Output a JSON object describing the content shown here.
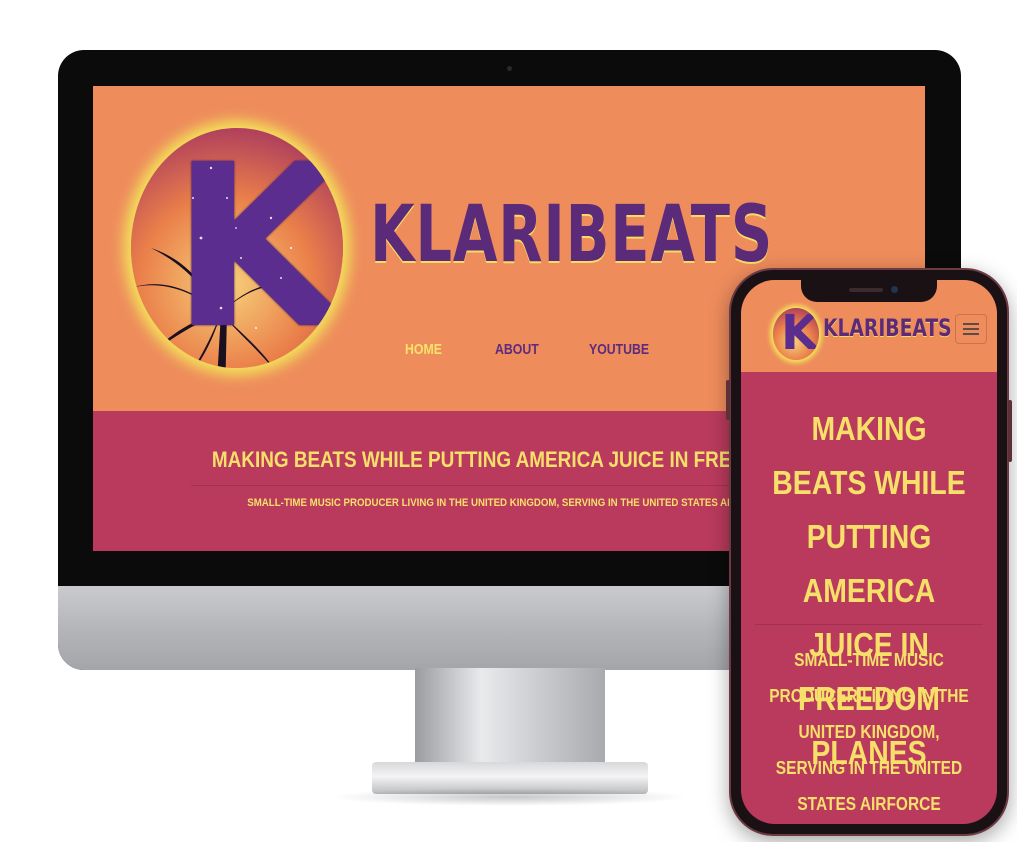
{
  "site": {
    "brand": "KLARIBEATS",
    "nav": [
      {
        "label": "HOME",
        "active": true
      },
      {
        "label": "ABOUT",
        "active": false
      },
      {
        "label": "YOUTUBE",
        "active": false
      }
    ],
    "headline_desktop": "MAKING BEATS WHILE PUTTING AMERICA JUICE IN FREEDOM P",
    "tagline_desktop": "SMALL-TIME MUSIC PRODUCER LIVING IN THE UNITED KINGDOM, SERVING IN THE UNITED STATES AIRFORCE",
    "headline": "MAKING BEATS WHILE PUTTING AMERICA JUICE IN FREEDOM PLANES",
    "tagline": "SMALL-TIME MUSIC PRODUCER LIVING IN THE UNITED KINGDOM, SERVING IN THE UNITED STATES AIRFORCE",
    "logo_letter": "K"
  },
  "colors": {
    "header_bg": "#ee8c5c",
    "hero_bg": "#b93a5c",
    "brand_purple": "#5b2b7a",
    "accent_yellow": "#f6e06a"
  },
  "icons": {
    "menu": "hamburger-icon"
  }
}
